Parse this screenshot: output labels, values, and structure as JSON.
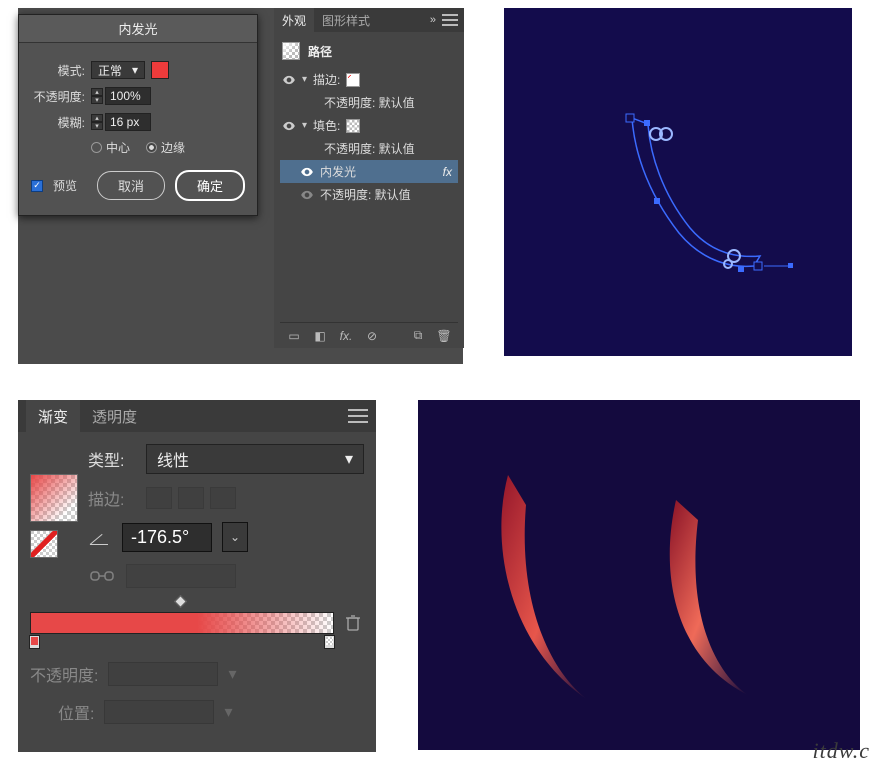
{
  "dialog": {
    "title": "内发光",
    "mode_label": "模式:",
    "mode_value": "正常",
    "opacity_label": "不透明度:",
    "opacity_value": "100%",
    "blur_label": "模糊:",
    "blur_value": "16 px",
    "radio_center": "中心",
    "radio_edge": "边缘",
    "preview": "预览",
    "cancel": "取消",
    "ok": "确定",
    "color": "#ed3b3b"
  },
  "appearance": {
    "tab_appearance": "外观",
    "tab_gfx_style": "图形样式",
    "path_title": "路径",
    "stroke_label": "描边:",
    "fill_label": "填色:",
    "inner_glow": "内发光",
    "opacity_default_1": "不透明度: 默认值",
    "opacity_default_2": "不透明度: 默认值",
    "opacity_default_3": "不透明度: 默认值"
  },
  "gradient": {
    "tab_gradient": "渐变",
    "tab_transparency": "透明度",
    "type_label": "类型:",
    "type_value": "线性",
    "stroke_label": "描边:",
    "angle_value": "-176.5°",
    "opacity_label": "不透明度:",
    "position_label": "位置:",
    "color_start": "#e74848"
  }
}
